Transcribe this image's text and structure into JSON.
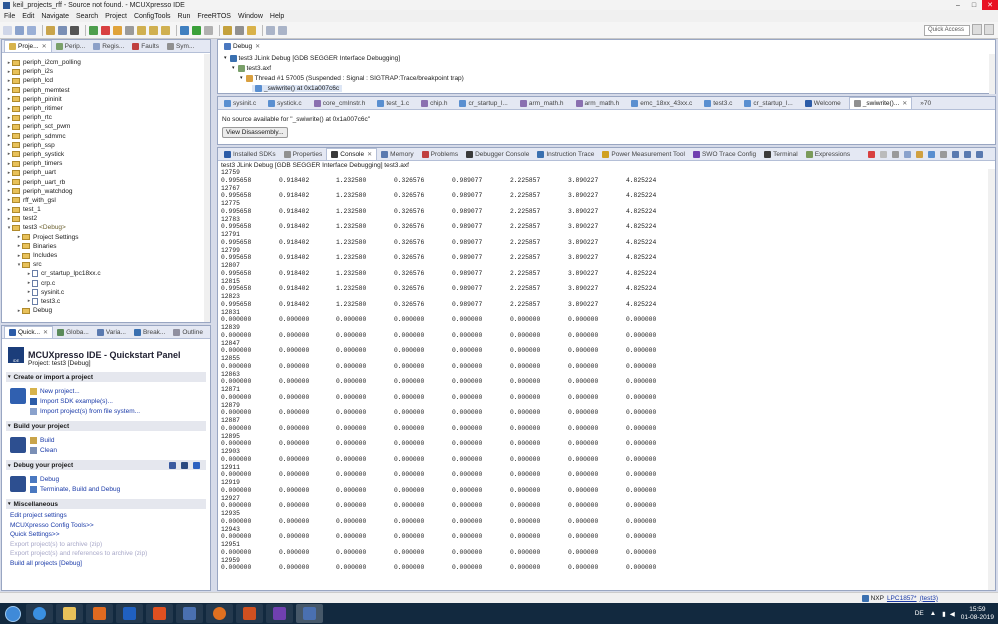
{
  "window": {
    "title": "keil_projects_rff - Source not found. - MCUXpresso IDE"
  },
  "menu": [
    "File",
    "Edit",
    "Navigate",
    "Search",
    "Project",
    "ConfigTools",
    "Run",
    "FreeRTOS",
    "Window",
    "Help"
  ],
  "quick_access": "Quick Access",
  "project_explorer": {
    "tabs": [
      "Proje...",
      "Perip...",
      "Regis...",
      "Faults",
      "Sym..."
    ],
    "items": [
      {
        "label": "periph_i2cm_polling",
        "kind": "folder",
        "indent": 0,
        "expander": "▸"
      },
      {
        "label": "periph_i2s",
        "kind": "folder",
        "indent": 0,
        "expander": "▸"
      },
      {
        "label": "periph_lcd",
        "kind": "folder",
        "indent": 0,
        "expander": "▸"
      },
      {
        "label": "periph_memtest",
        "kind": "folder",
        "indent": 0,
        "expander": "▸"
      },
      {
        "label": "periph_pininit",
        "kind": "folder",
        "indent": 0,
        "expander": "▸"
      },
      {
        "label": "periph_ritimer",
        "kind": "folder",
        "indent": 0,
        "expander": "▸"
      },
      {
        "label": "periph_rtc",
        "kind": "folder",
        "indent": 0,
        "expander": "▸"
      },
      {
        "label": "periph_sct_pwm",
        "kind": "folder",
        "indent": 0,
        "expander": "▸"
      },
      {
        "label": "periph_sdmmc",
        "kind": "folder",
        "indent": 0,
        "expander": "▸"
      },
      {
        "label": "periph_ssp",
        "kind": "folder",
        "indent": 0,
        "expander": "▸"
      },
      {
        "label": "periph_systick",
        "kind": "folder",
        "indent": 0,
        "expander": "▸"
      },
      {
        "label": "periph_timers",
        "kind": "folder",
        "indent": 0,
        "expander": "▸"
      },
      {
        "label": "periph_uart",
        "kind": "folder",
        "indent": 0,
        "expander": "▸"
      },
      {
        "label": "periph_uart_rb",
        "kind": "folder",
        "indent": 0,
        "expander": "▸"
      },
      {
        "label": "periph_watchdog",
        "kind": "folder",
        "indent": 0,
        "expander": "▸"
      },
      {
        "label": "rff_with_gsl",
        "kind": "folder",
        "indent": 0,
        "expander": "▸"
      },
      {
        "label": "test_1",
        "kind": "folder",
        "indent": 0,
        "expander": "▸"
      },
      {
        "label": "test2",
        "kind": "folder",
        "indent": 0,
        "expander": "▸"
      },
      {
        "label": "test3",
        "suffix": "<Debug>",
        "kind": "folder",
        "indent": 0,
        "expander": "▾"
      },
      {
        "label": "Project Settings",
        "kind": "folder",
        "indent": 1,
        "expander": "▸"
      },
      {
        "label": "Binaries",
        "kind": "folder",
        "indent": 1,
        "expander": "▸"
      },
      {
        "label": "Includes",
        "kind": "folder",
        "indent": 1,
        "expander": "▸"
      },
      {
        "label": "src",
        "kind": "folder",
        "indent": 1,
        "expander": "▾"
      },
      {
        "label": "cr_startup_lpc18xx.c",
        "kind": "file",
        "indent": 2,
        "expander": "▸"
      },
      {
        "label": "crp.c",
        "kind": "file",
        "indent": 2,
        "expander": "▸"
      },
      {
        "label": "sysinit.c",
        "kind": "file",
        "indent": 2,
        "expander": "▸"
      },
      {
        "label": "test3.c",
        "kind": "file",
        "indent": 2,
        "expander": "▸"
      },
      {
        "label": "Debug",
        "kind": "folder",
        "indent": 1,
        "expander": "▸"
      }
    ]
  },
  "quickstart": {
    "tabs": [
      "Quick...",
      "Globa...",
      "Varia...",
      "Break...",
      "Outline"
    ],
    "title": "MCUXpresso IDE - Quickstart Panel",
    "project": "Project: test3 [Debug]",
    "sections": {
      "create": {
        "title": "Create or import a project",
        "links": [
          "New project...",
          "Import SDK example(s)...",
          "Import project(s) from file system..."
        ]
      },
      "build": {
        "title": "Build your project",
        "links": [
          "Build",
          "Clean"
        ]
      },
      "debug": {
        "title": "Debug your project",
        "links": [
          "Debug",
          "Terminate, Build and Debug"
        ]
      },
      "misc": {
        "title": "Miscellaneous",
        "links": [
          "Edit project settings",
          "MCUXpresso Config Tools>>",
          "Quick Settings>>"
        ],
        "disabled_links": [
          "Export project(s) to archive (zip)",
          "Export project(s) and references to archive (zip)"
        ],
        "last_link": "Build all projects [Debug]"
      }
    }
  },
  "debug_view": {
    "tab": "Debug",
    "session": "test3 JLink Debug [GDB SEGGER Interface Debugging]",
    "binary": "test3.axf",
    "thread": "Thread #1 57005 (Suspended : Signal : SIGTRAP:Trace/breakpoint trap)",
    "frame": "_swiwrite() at 0x1a007c6c"
  },
  "editor": {
    "tabs": [
      "sysinit.c",
      "systick.c",
      "core_cmInstr.h",
      "test_1.c",
      "chip.h",
      "cr_startup_l...",
      "arm_math.h",
      "arm_math.h",
      "emc_18xx_43xx.c",
      "test3.c",
      "cr_startup_l...",
      "Welcome",
      "_swiwrite()..."
    ],
    "overflow": "»70",
    "message": "No source available for \"_swiwrite() at 0x1a007c6c\"",
    "button": "View Disassembly..."
  },
  "bottom_tabs": [
    "Installed SDKs",
    "Properties",
    "Console",
    "Memory",
    "Problems",
    "Debugger Console",
    "Instruction Trace",
    "Power Measurement Tool",
    "SWO Trace Config",
    "Terminal",
    "Expressions"
  ],
  "console": {
    "header": "test3 JLink Debug [GDB SEGGER Interface Debugging] test3.axf",
    "lines": [
      [
        "12759"
      ],
      [
        "0.995658",
        "0.918402",
        "1.232580",
        "0.326576",
        "0.989077",
        "2.225857",
        "3.890227",
        "4.825224"
      ],
      [
        "12767"
      ],
      [
        "0.995658",
        "0.918402",
        "1.232580",
        "0.326576",
        "0.989077",
        "2.225857",
        "3.890227",
        "4.825224"
      ],
      [
        "12775"
      ],
      [
        "0.995658",
        "0.918402",
        "1.232580",
        "0.326576",
        "0.989077",
        "2.225857",
        "3.890227",
        "4.825224"
      ],
      [
        "12783"
      ],
      [
        "0.995658",
        "0.918402",
        "1.232580",
        "0.326576",
        "0.989077",
        "2.225857",
        "3.890227",
        "4.825224"
      ],
      [
        "12791"
      ],
      [
        "0.995658",
        "0.918402",
        "1.232580",
        "0.326576",
        "0.989077",
        "2.225857",
        "3.890227",
        "4.825224"
      ],
      [
        "12799"
      ],
      [
        "0.995658",
        "0.918402",
        "1.232580",
        "0.326576",
        "0.989077",
        "2.225857",
        "3.890227",
        "4.825224"
      ],
      [
        "12807"
      ],
      [
        "0.995658",
        "0.918402",
        "1.232580",
        "0.326576",
        "0.989077",
        "2.225857",
        "3.890227",
        "4.825224"
      ],
      [
        "12815"
      ],
      [
        "0.995658",
        "0.918402",
        "1.232580",
        "0.326576",
        "0.989077",
        "2.225857",
        "3.890227",
        "4.825224"
      ],
      [
        "12823"
      ],
      [
        "0.995658",
        "0.918402",
        "1.232580",
        "0.326576",
        "0.989077",
        "2.225857",
        "3.890227",
        "4.825224"
      ],
      [
        "12831"
      ],
      [
        "0.000000",
        "0.000000",
        "0.000000",
        "0.000000",
        "0.000000",
        "0.000000",
        "0.000000",
        "0.000000"
      ],
      [
        "12839"
      ],
      [
        "0.000000",
        "0.000000",
        "0.000000",
        "0.000000",
        "0.000000",
        "0.000000",
        "0.000000",
        "0.000000"
      ],
      [
        "12847"
      ],
      [
        "0.000000",
        "0.000000",
        "0.000000",
        "0.000000",
        "0.000000",
        "0.000000",
        "0.000000",
        "0.000000"
      ],
      [
        "12855"
      ],
      [
        "0.000000",
        "0.000000",
        "0.000000",
        "0.000000",
        "0.000000",
        "0.000000",
        "0.000000",
        "0.000000"
      ],
      [
        "12863"
      ],
      [
        "0.000000",
        "0.000000",
        "0.000000",
        "0.000000",
        "0.000000",
        "0.000000",
        "0.000000",
        "0.000000"
      ],
      [
        "12871"
      ],
      [
        "0.000000",
        "0.000000",
        "0.000000",
        "0.000000",
        "0.000000",
        "0.000000",
        "0.000000",
        "0.000000"
      ],
      [
        "12879"
      ],
      [
        "0.000000",
        "0.000000",
        "0.000000",
        "0.000000",
        "0.000000",
        "0.000000",
        "0.000000",
        "0.000000"
      ],
      [
        "12887"
      ],
      [
        "0.000000",
        "0.000000",
        "0.000000",
        "0.000000",
        "0.000000",
        "0.000000",
        "0.000000",
        "0.000000"
      ],
      [
        "12895"
      ],
      [
        "0.000000",
        "0.000000",
        "0.000000",
        "0.000000",
        "0.000000",
        "0.000000",
        "0.000000",
        "0.000000"
      ],
      [
        "12903"
      ],
      [
        "0.000000",
        "0.000000",
        "0.000000",
        "0.000000",
        "0.000000",
        "0.000000",
        "0.000000",
        "0.000000"
      ],
      [
        "12911"
      ],
      [
        "0.000000",
        "0.000000",
        "0.000000",
        "0.000000",
        "0.000000",
        "0.000000",
        "0.000000",
        "0.000000"
      ],
      [
        "12919"
      ],
      [
        "0.000000",
        "0.000000",
        "0.000000",
        "0.000000",
        "0.000000",
        "0.000000",
        "0.000000",
        "0.000000"
      ],
      [
        "12927"
      ],
      [
        "0.000000",
        "0.000000",
        "0.000000",
        "0.000000",
        "0.000000",
        "0.000000",
        "0.000000",
        "0.000000"
      ],
      [
        "12935"
      ],
      [
        "0.000000",
        "0.000000",
        "0.000000",
        "0.000000",
        "0.000000",
        "0.000000",
        "0.000000",
        "0.000000"
      ],
      [
        "12943"
      ],
      [
        "0.000000",
        "0.000000",
        "0.000000",
        "0.000000",
        "0.000000",
        "0.000000",
        "0.000000",
        "0.000000"
      ],
      [
        "12951"
      ],
      [
        "0.000000",
        "0.000000",
        "0.000000",
        "0.000000",
        "0.000000",
        "0.000000",
        "0.000000",
        "0.000000"
      ],
      [
        "12959"
      ],
      [
        "0.000000",
        "0.000000",
        "0.000000",
        "0.000000",
        "0.000000",
        "0.000000",
        "0.000000",
        "0.000000"
      ]
    ]
  },
  "status": {
    "prefix": "NXP",
    "chip": "LPC1857*",
    "project": "(test3)"
  },
  "taskbar": {
    "lang": "DE",
    "time": "15:59",
    "date": "01-08-2019"
  }
}
